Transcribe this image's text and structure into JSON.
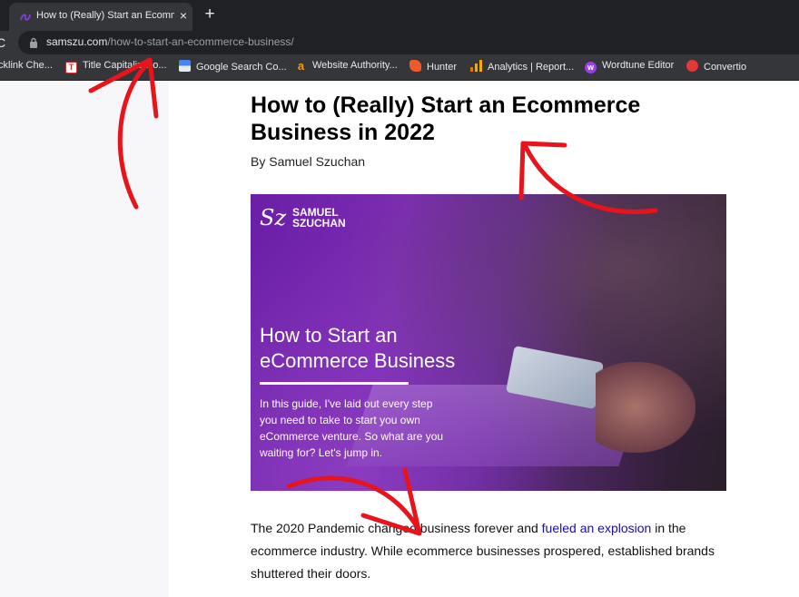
{
  "browser": {
    "tab_title": "How to (Really) Start an Ecomm",
    "tab_close_glyph": "×",
    "new_tab_glyph": "+",
    "reload_glyph": "C",
    "url_host": "samszu.com",
    "url_path": "/how-to-start-an-ecommerce-business/"
  },
  "bookmarks": [
    {
      "label": "cklink Che...",
      "icon": "none"
    },
    {
      "label": "Title Capitalizatio...",
      "icon": "title-capitalization-icon",
      "color": "#ffffff"
    },
    {
      "label": "Google Search Co...",
      "icon": "google-search-console-icon",
      "color": "#4285f4"
    },
    {
      "label": "Website Authority...",
      "icon": "amazon-icon",
      "color": "#ff9900"
    },
    {
      "label": "Hunter",
      "icon": "hunter-icon",
      "color": "#f05a28"
    },
    {
      "label": "Analytics | Report...",
      "icon": "analytics-icon",
      "color": "#f9ab00"
    },
    {
      "label": "Wordtune Editor",
      "icon": "wordtune-icon",
      "color": "#9b3df0"
    },
    {
      "label": "Convertio",
      "icon": "convertio-icon",
      "color": "#e53935"
    }
  ],
  "article": {
    "title": "How to (Really) Start an Ecommerce Business in 2022",
    "byline": "By Samuel Szuchan",
    "hero": {
      "logo_mark": "Sz",
      "logo_line1": "SAMUEL",
      "logo_line2": "SZUCHAN",
      "heading_line1": "How to Start an",
      "heading_line2": "eCommerce Business",
      "body_lines": [
        "In this guide, I've laid out every step",
        "you need to take to start you own",
        "eCommerce venture. So what are you",
        "waiting for? Let's jump in."
      ]
    },
    "para_before": "The 2020 Pandemic changed business forever and ",
    "para_link": "fueled an explosion",
    "para_after": " in the ecommerce industry. While ecommerce businesses prospered, established brands shuttered their doors."
  },
  "colors": {
    "annotation_arrow": "#e8141c",
    "link": "#1a0dab"
  }
}
